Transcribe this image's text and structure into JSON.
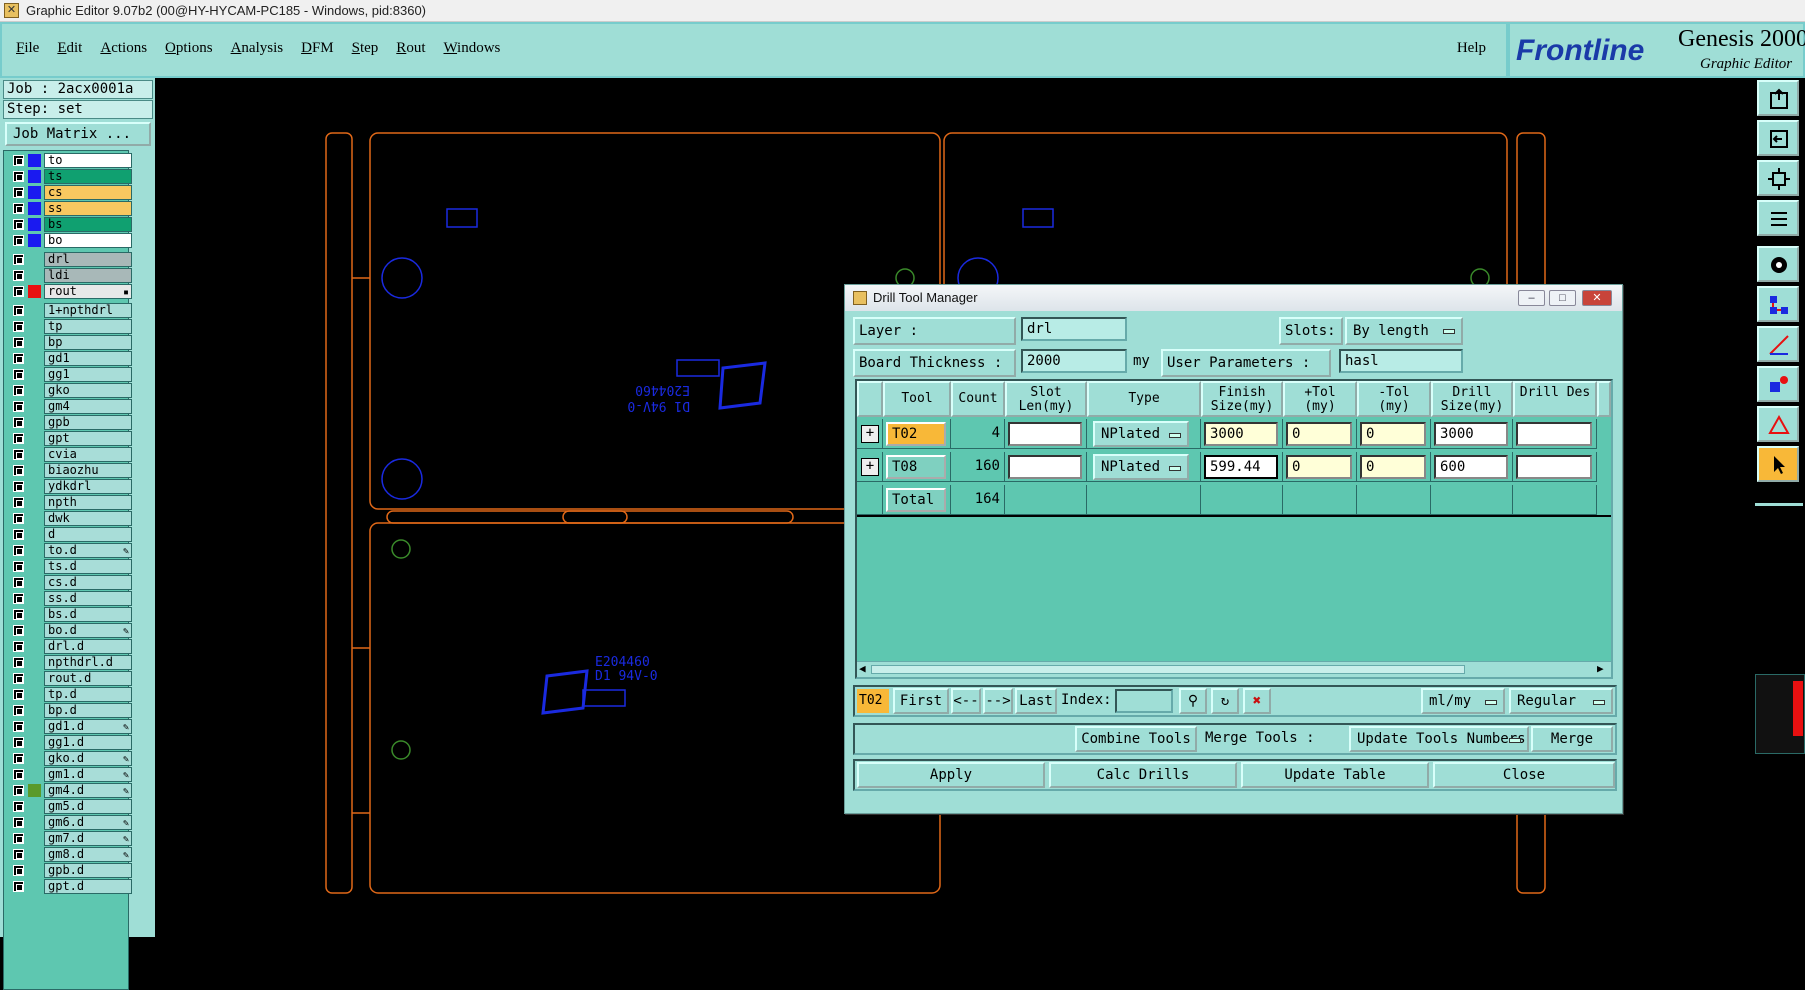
{
  "window": {
    "title": "Graphic Editor 9.07b2 (00@HY-HYCAM-PC185 - Windows, pid:8360)"
  },
  "menu": {
    "items": [
      "File",
      "Edit",
      "Actions",
      "Options",
      "Analysis",
      "DFM",
      "Step",
      "Rout",
      "Windows"
    ],
    "help": "Help"
  },
  "logo": {
    "brand": "Frontline",
    "product": "Genesis 2000",
    "subtitle": "Graphic Editor"
  },
  "job": {
    "job": "Job : 2acx0001a",
    "step": "Step: set",
    "matrix_button": "Job Matrix ..."
  },
  "layers": [
    {
      "name": "to",
      "color": "#1a1af0",
      "bg": "#ffffff"
    },
    {
      "name": "ts",
      "color": "#1a1af0",
      "bg": "#10a070"
    },
    {
      "name": "cs",
      "color": "#1a1af0",
      "bg": "#f8c860"
    },
    {
      "name": "ss",
      "color": "#1a1af0",
      "bg": "#f8c860"
    },
    {
      "name": "bs",
      "color": "#1a1af0",
      "bg": "#10a070"
    },
    {
      "name": "bo",
      "color": "#1a1af0",
      "bg": "#ffffff"
    },
    {
      "name": "drl",
      "color": "",
      "bg": "#a8b8b8"
    },
    {
      "name": "ldi",
      "color": "",
      "bg": "#a8b8b8"
    },
    {
      "name": "rout",
      "color": "#e81010",
      "bg": "#e8e8e8",
      "mark": "▪"
    },
    {
      "name": "1+npthdrl",
      "color": "",
      "bg": "#a8ddd8"
    },
    {
      "name": "tp",
      "color": "",
      "bg": "#a8ddd8"
    },
    {
      "name": "bp",
      "color": "",
      "bg": "#a8ddd8"
    },
    {
      "name": "gd1",
      "color": "",
      "bg": "#a8ddd8"
    },
    {
      "name": "gg1",
      "color": "",
      "bg": "#a8ddd8"
    },
    {
      "name": "gko",
      "color": "",
      "bg": "#a8ddd8"
    },
    {
      "name": "gm4",
      "color": "",
      "bg": "#a8ddd8"
    },
    {
      "name": "gpb",
      "color": "",
      "bg": "#a8ddd8"
    },
    {
      "name": "gpt",
      "color": "",
      "bg": "#a8ddd8"
    },
    {
      "name": "cvia",
      "color": "",
      "bg": "#a8ddd8"
    },
    {
      "name": "biaozhu",
      "color": "",
      "bg": "#a8ddd8"
    },
    {
      "name": "ydkdrl",
      "color": "",
      "bg": "#a8ddd8"
    },
    {
      "name": "npth",
      "color": "",
      "bg": "#a8ddd8"
    },
    {
      "name": "dwk",
      "color": "",
      "bg": "#a8ddd8"
    },
    {
      "name": "d",
      "color": "",
      "bg": "#a8ddd8"
    },
    {
      "name": "to.d",
      "color": "",
      "bg": "#a8ddd8",
      "mark": "✎"
    },
    {
      "name": "ts.d",
      "color": "",
      "bg": "#a8ddd8"
    },
    {
      "name": "cs.d",
      "color": "",
      "bg": "#a8ddd8"
    },
    {
      "name": "ss.d",
      "color": "",
      "bg": "#a8ddd8"
    },
    {
      "name": "bs.d",
      "color": "",
      "bg": "#a8ddd8"
    },
    {
      "name": "bo.d",
      "color": "",
      "bg": "#a8ddd8",
      "mark": "✎"
    },
    {
      "name": "drl.d",
      "color": "",
      "bg": "#a8ddd8"
    },
    {
      "name": "npthdrl.d",
      "color": "",
      "bg": "#a8ddd8"
    },
    {
      "name": "rout.d",
      "color": "",
      "bg": "#a8ddd8"
    },
    {
      "name": "tp.d",
      "color": "",
      "bg": "#a8ddd8"
    },
    {
      "name": "bp.d",
      "color": "",
      "bg": "#a8ddd8"
    },
    {
      "name": "gd1.d",
      "color": "",
      "bg": "#a8ddd8",
      "mark": "✎"
    },
    {
      "name": "gg1.d",
      "color": "",
      "bg": "#a8ddd8"
    },
    {
      "name": "gko.d",
      "color": "",
      "bg": "#a8ddd8",
      "mark": "✎"
    },
    {
      "name": "gm1.d",
      "color": "",
      "bg": "#a8ddd8",
      "mark": "✎"
    },
    {
      "name": "gm4.d",
      "color": "#5a9a2a",
      "bg": "#a8ddd8",
      "mark": "✎"
    },
    {
      "name": "gm5.d",
      "color": "",
      "bg": "#a8ddd8"
    },
    {
      "name": "gm6.d",
      "color": "",
      "bg": "#a8ddd8",
      "mark": "✎"
    },
    {
      "name": "gm7.d",
      "color": "",
      "bg": "#a8ddd8",
      "mark": "✎"
    },
    {
      "name": "gm8.d",
      "color": "",
      "bg": "#a8ddd8",
      "mark": "✎"
    },
    {
      "name": "gpb.d",
      "color": "",
      "bg": "#a8ddd8"
    },
    {
      "name": "gpt.d",
      "color": "",
      "bg": "#a8ddd8"
    }
  ],
  "canvas": {
    "silk1": "E204460",
    "silk2": "D1 94V-0",
    "ref1": "E204460",
    "ref2": "D1 94V-0"
  },
  "dialog": {
    "title": "Drill Tool Manager",
    "layer_label": "Layer          :",
    "layer_value": "drl",
    "slots_label": "Slots:",
    "slots_value": "By length",
    "thickness_label": "Board Thickness :",
    "thickness_value": "2000",
    "thickness_unit": "my",
    "user_params_label": "User Parameters :",
    "user_params_value": "hasl",
    "columns": [
      "Tool",
      "Count",
      "Slot Len(my)",
      "Type",
      "Finish Size(my)",
      "+Tol (my)",
      "-Tol (my)",
      "Drill Size(my)",
      "Drill Des"
    ],
    "rows": [
      {
        "tool": "T02",
        "count": "4",
        "slot": "",
        "type": "NPlated",
        "finish": "3000",
        "ptol": "0",
        "ntol": "0",
        "drill": "3000",
        "des": ""
      },
      {
        "tool": "T08",
        "count": "160",
        "slot": "",
        "type": "NPlated",
        "finish": "599.44",
        "ptol": "0",
        "ntol": "0",
        "drill": "600",
        "des": ""
      }
    ],
    "total_label": "Total",
    "total_count": "164",
    "current_tool": "T02",
    "nav": {
      "first": "First",
      "prev": "<--",
      "next": "-->",
      "last": "Last",
      "index_label": "Index:",
      "units": "ml/my",
      "mode": "Regular"
    },
    "actions": {
      "combine": "Combine Tools",
      "merge_label": "Merge Tools :",
      "merge_option": "Update Tools Numbers",
      "merge": "Merge"
    },
    "bottom": {
      "apply": "Apply",
      "calc": "Calc Drills",
      "update": "Update Table",
      "close": "Close"
    }
  },
  "colors": {
    "panel": "#9fded6",
    "rout": "#e06818",
    "silk": "#1a2ae0",
    "annotation": "#e020e8"
  }
}
